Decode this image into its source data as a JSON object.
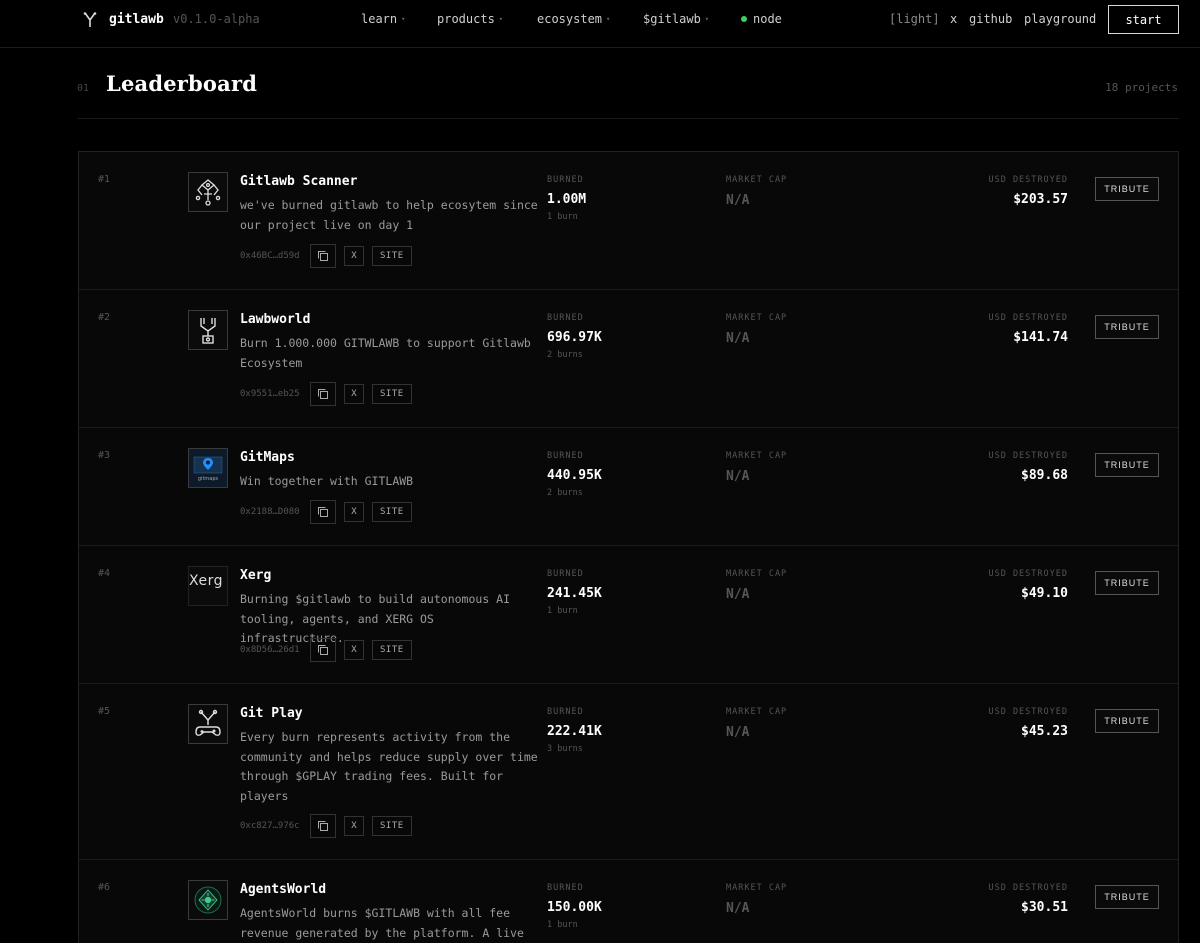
{
  "nav": {
    "brand": "gitlawb",
    "version": "v0.1.0-alpha",
    "menu": [
      {
        "label": "learn"
      },
      {
        "label": "products"
      },
      {
        "label": "ecosystem"
      },
      {
        "label": "$gitlawb"
      }
    ],
    "node_label": "node",
    "theme_toggle": "[light]",
    "x_link": "x",
    "github_link": "github",
    "playground_link": "playground",
    "start_label": "start",
    "node_color": "#3ecf5e"
  },
  "header": {
    "section_number": "01",
    "title": "Leaderboard",
    "project_count": "18 projects"
  },
  "labels": {
    "burned": "BURNED",
    "market_cap": "MARKET CAP",
    "usd_destroyed": "USD DESTROYED",
    "tribute": "TRIBUTE",
    "x": "X",
    "site": "SITE"
  },
  "projects": [
    {
      "rank": "#1",
      "name": "Gitlawb Scanner",
      "description": "we've burned gitlawb to help ecosytem since our project live on day 1",
      "address": "0x46BC…d59d",
      "burned": "1.00M",
      "burns": "1 burn",
      "market_cap": "N/A",
      "usd_destroyed": "$203.57",
      "icon": "scanner-logo-icon"
    },
    {
      "rank": "#2",
      "name": "Lawbworld",
      "description": "Burn 1.000.000 GITWLAWB to support Gitlawb Ecosystem",
      "address": "0x9551…eb25",
      "burned": "696.97K",
      "burns": "2 burns",
      "market_cap": "N/A",
      "usd_destroyed": "$141.74",
      "icon": "lawbworld-logo-icon"
    },
    {
      "rank": "#3",
      "name": "GitMaps",
      "description": "Win together with GITLAWB",
      "address": "0x2188…D080",
      "burned": "440.95K",
      "burns": "2 burns",
      "market_cap": "N/A",
      "usd_destroyed": "$89.68",
      "icon": "gitmaps-logo-icon",
      "icon_text": "gitmaps"
    },
    {
      "rank": "#4",
      "name": "Xerg",
      "description": "Burning $gitlawb to build autonomous AI tooling, agents, and XERG OS infrastructure.",
      "address": "0x8D56…26d1",
      "burned": "241.45K",
      "burns": "1 burn",
      "market_cap": "N/A",
      "usd_destroyed": "$49.10",
      "icon": "broken-image-icon",
      "icon_text": "Xerg"
    },
    {
      "rank": "#5",
      "name": "Git Play",
      "description": "Every burn represents activity from the community and helps reduce supply over time through $GPLAY trading fees. Built for players",
      "address": "0xc827…976c",
      "burned": "222.41K",
      "burns": "3 burns",
      "market_cap": "N/A",
      "usd_destroyed": "$45.23",
      "icon": "gitplay-logo-icon"
    },
    {
      "rank": "#6",
      "name": "AgentsWorld",
      "description": "AgentsWorld burns $GITLAWB with all fee revenue generated by the platform. A live",
      "address": "",
      "burned": "150.00K",
      "burns": "1 burn",
      "market_cap": "N/A",
      "usd_destroyed": "$30.51",
      "icon": "agentsworld-logo-icon"
    }
  ]
}
